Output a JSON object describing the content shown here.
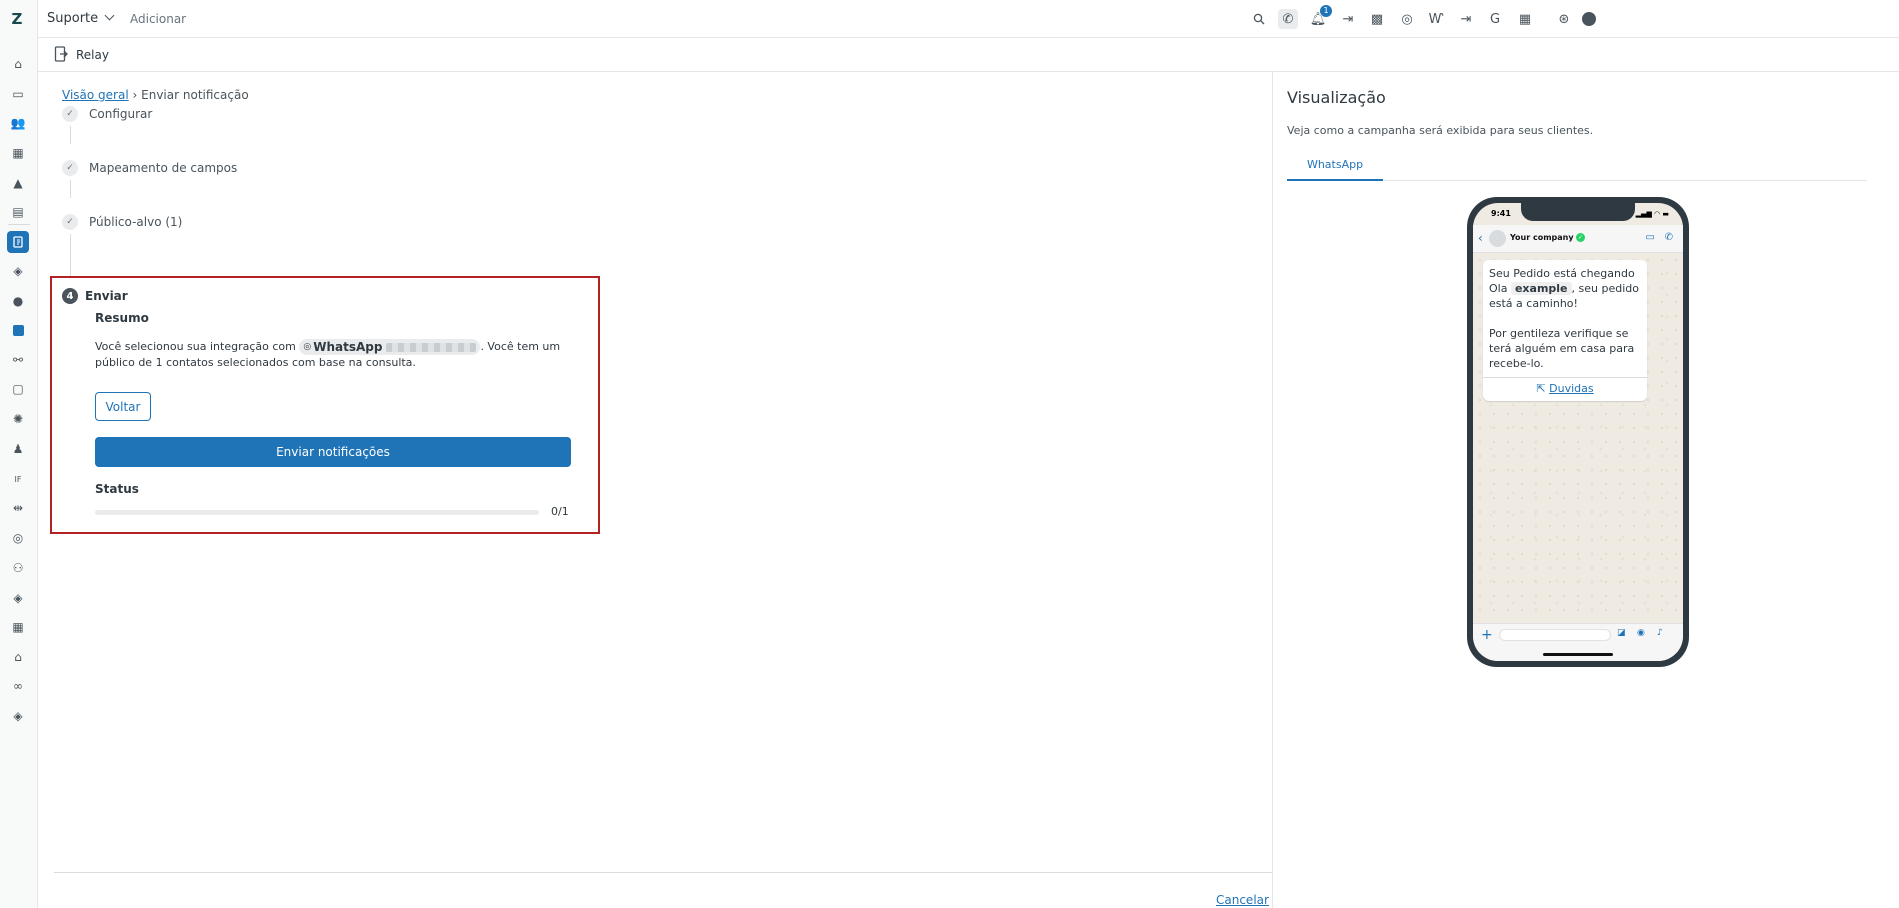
{
  "topbar": {
    "product": "Suporte",
    "add_label": "Adicionar",
    "notifications_count": "1"
  },
  "subheader": {
    "title": "Relay"
  },
  "breadcrumb": {
    "parent": "Visão geral",
    "separator": "›",
    "current": "Enviar notificação"
  },
  "steps": [
    {
      "label": "Configurar",
      "state": "done"
    },
    {
      "label": "Mapeamento de campos",
      "state": "done"
    },
    {
      "label": "Público-alvo (1)",
      "state": "done"
    }
  ],
  "send_step": {
    "number": "4",
    "title": "Enviar",
    "summary_title": "Resumo",
    "summary_prefix": "Você selecionou sua integração com",
    "integration_name": "WhatsApp",
    "summary_suffix": ". Você tem um público de 1 contatos selecionados com base na consulta.",
    "back_label": "Voltar",
    "send_label": "Enviar notificações",
    "status_title": "Status",
    "progress_text": "0/1",
    "progress_fraction": 0
  },
  "footer": {
    "cancel_label": "Cancelar"
  },
  "preview": {
    "title": "Visualização",
    "subtitle": "Veja como a campanha será exibida para seus clientes.",
    "tab_label": "WhatsApp",
    "phone_time": "9:41",
    "company_name": "Your company",
    "message_line1": "Seu Pedido está chegando",
    "message_ola": "Ola",
    "message_var": "example",
    "message_after_var": ", seu pedido está a caminho!",
    "message_para2": "Por gentileza verifique se terá alguém em casa para recebe-lo.",
    "button_label": "Duvidas"
  },
  "colors": {
    "accent": "#1f73b7",
    "highlight_border": "#b22222",
    "whatsapp_verified": "#25d366"
  }
}
